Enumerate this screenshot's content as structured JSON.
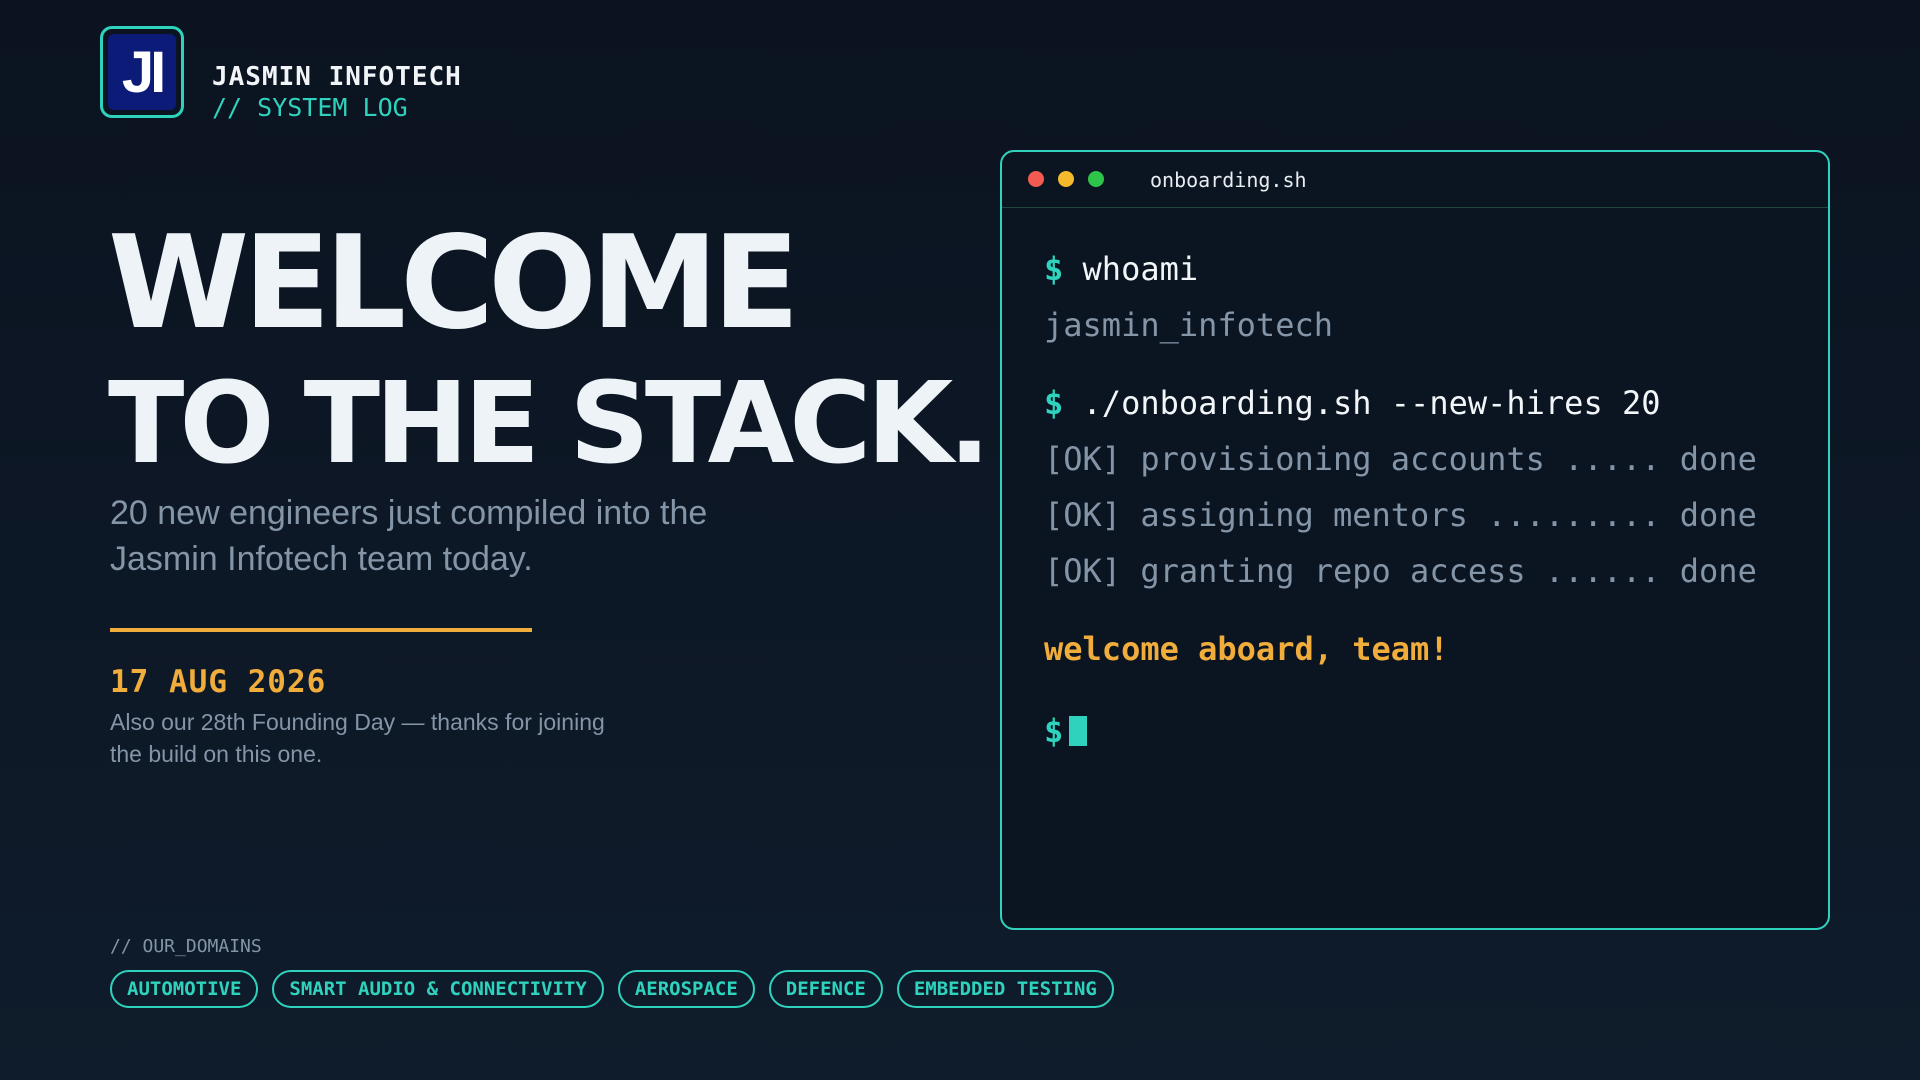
{
  "brand": {
    "logo_text": "JI",
    "name": "JASMIN INFOTECH",
    "subtitle": "// SYSTEM LOG"
  },
  "hero": {
    "line1": "WELCOME",
    "line2": "TO THE STACK.",
    "lead": "20 new engineers just compiled into the Jasmin Infotech team today."
  },
  "event": {
    "date": "17 AUG 2026",
    "note": "Also our 28th Founding Day — thanks for joining the build on this one."
  },
  "terminal": {
    "title": "onboarding.sh",
    "prompt": "$",
    "lines": [
      {
        "cmd": "whoami"
      },
      {
        "out": "jasmin_infotech"
      },
      {
        "cmd": "./onboarding.sh --new-hires 20"
      },
      {
        "out": "[OK] provisioning accounts ..... done"
      },
      {
        "out": "[OK] assigning mentors ......... done"
      },
      {
        "out": "[OK] granting repo access ...... done"
      },
      {
        "welcome": "welcome aboard, team!"
      }
    ]
  },
  "domains": {
    "label": "// OUR_DOMAINS",
    "tags": [
      "AUTOMOTIVE",
      "SMART AUDIO & CONNECTIVITY",
      "AEROSPACE",
      "DEFENCE",
      "EMBEDDED TESTING"
    ]
  },
  "colors": {
    "accent": "#2fd3bd",
    "highlight": "#f0ad3c",
    "muted": "#8495a8",
    "background": "#0b1320"
  }
}
